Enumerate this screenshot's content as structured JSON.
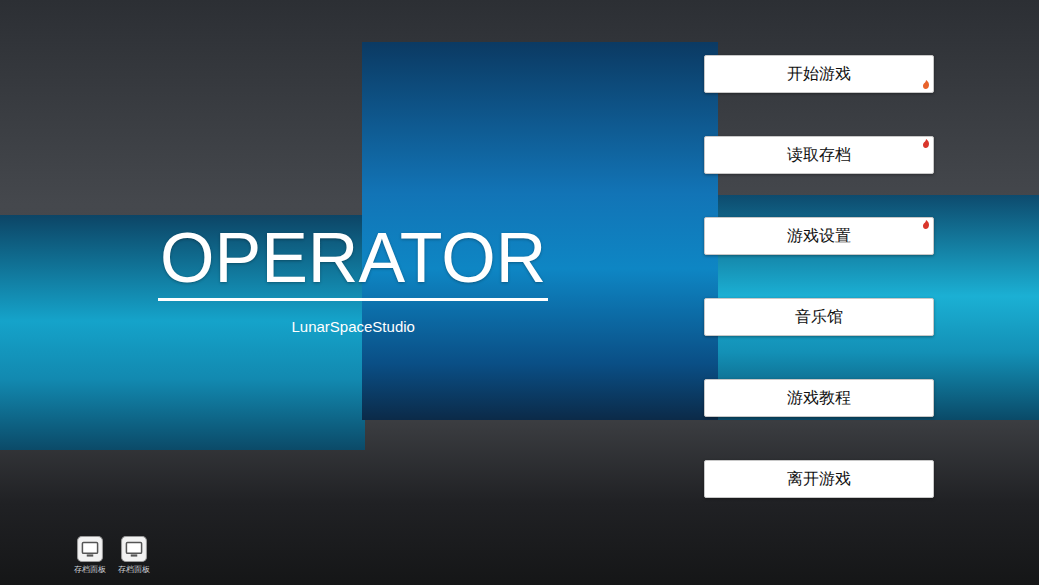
{
  "title": "OPERATOR",
  "studio": "LunarSpaceStudio",
  "menu": [
    {
      "label": "开始游戏",
      "badge": {
        "corner": "bottom",
        "color": "#e8622a"
      }
    },
    {
      "label": "读取存档",
      "badge": {
        "corner": "top",
        "color": "#d9362b"
      }
    },
    {
      "label": "游戏设置",
      "badge": {
        "corner": "top",
        "color": "#d9362b"
      }
    },
    {
      "label": "音乐馆",
      "badge": null
    },
    {
      "label": "游戏教程",
      "badge": null
    },
    {
      "label": "离开游戏",
      "badge": null
    }
  ],
  "dock": [
    {
      "label": "存档面板"
    },
    {
      "label": "存档面板"
    }
  ]
}
